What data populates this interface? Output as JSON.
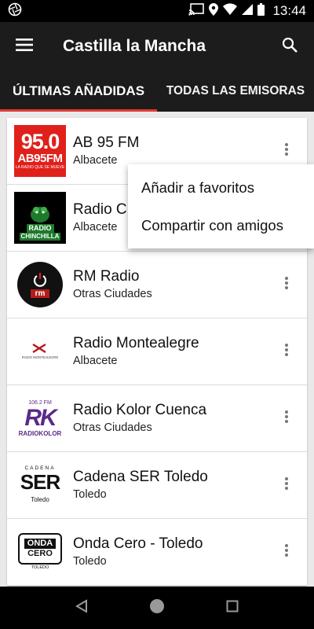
{
  "status_bar": {
    "time": "13:44"
  },
  "app_bar": {
    "title": "Castilla la Mancha"
  },
  "tabs": [
    {
      "label": "ÚLTIMAS AÑADIDAS",
      "active": true
    },
    {
      "label": "TODAS LAS EMISORAS",
      "active": false
    }
  ],
  "stations": [
    {
      "name": "AB 95 FM",
      "city": "Albacete",
      "logo": {
        "big": "95.0",
        "sub": "AB95FM",
        "tagline": "LA RADIO QUE SE MUEVE"
      }
    },
    {
      "name": "Radio C",
      "city": "Albacete",
      "logo": {
        "line1": "RADIO",
        "line2": "CHINCHILLA"
      }
    },
    {
      "name": "RM Radio",
      "city": "Otras Ciudades",
      "logo": {
        "text": "rm"
      }
    },
    {
      "name": "Radio Montealegre",
      "city": "Albacete",
      "logo": {
        "text": "RADIO MONTEALEGRE"
      }
    },
    {
      "name": "Radio Kolor Cuenca",
      "city": "Otras Ciudades",
      "logo": {
        "freq": "106.2 FM",
        "mark": "RK",
        "word": "RADIOKOLOR"
      }
    },
    {
      "name": "Cadena SER Toledo",
      "city": "Toledo",
      "logo": {
        "top": "CADENA",
        "mark": "SER",
        "bottom": "Toledo"
      }
    },
    {
      "name": "Onda Cero - Toledo",
      "city": "Toledo",
      "logo": {
        "line1": "ONDA",
        "line2": "CERO",
        "bottom": "TOLEDO"
      }
    }
  ],
  "popup_menu": [
    {
      "label": "Añadir a favoritos"
    },
    {
      "label": "Compartir con amigos"
    }
  ],
  "colors": {
    "tab_indicator": "#e53935",
    "app_bar": "#1c1c1c",
    "list_bg": "#e9e9e9",
    "ab95_red": "#e0201b",
    "chinchilla_green": "#1d7a2c",
    "kolor_purple": "#5b2a86"
  }
}
